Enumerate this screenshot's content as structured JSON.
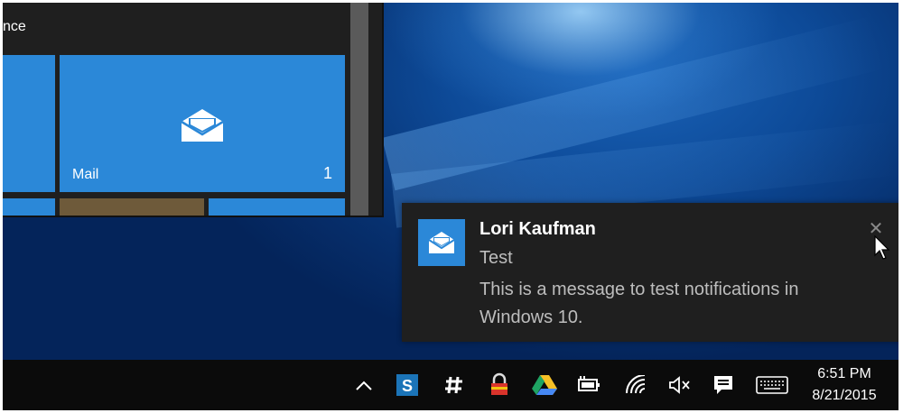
{
  "start_menu": {
    "partial_label": "nce",
    "mail_tile": {
      "name": "Mail",
      "badge_count": "1",
      "icon": "mail-icon"
    }
  },
  "notification": {
    "icon": "mail-icon",
    "sender": "Lori Kaufman",
    "subject": "Test",
    "body": "This is a message to test notifications in Windows 10.",
    "close_icon": "close-icon"
  },
  "taskbar": {
    "tray_icons": [
      "chevron-up-icon",
      "snagit-icon",
      "slack-icon",
      "security-lock-icon",
      "google-drive-icon",
      "battery-power-icon",
      "wifi-icon",
      "volume-muted-icon",
      "action-center-icon",
      "touch-keyboard-icon"
    ],
    "clock": {
      "time": "6:51 PM",
      "date": "8/21/2015"
    }
  },
  "colors": {
    "accent": "#2b88d8",
    "toast_bg": "#1f1f1f",
    "taskbar_bg": "#0b0b0b"
  }
}
